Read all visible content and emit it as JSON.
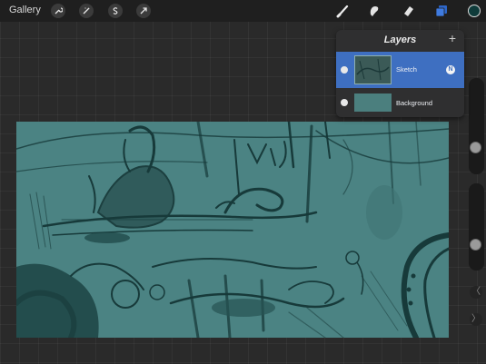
{
  "toolbar": {
    "gallery_label": "Gallery",
    "left_icons": [
      "wrench-icon",
      "magic-wand-icon",
      "selection-s-icon",
      "transform-arrow-icon"
    ],
    "right_icons": [
      "brush-icon",
      "smudge-icon",
      "eraser-icon",
      "layers-icon"
    ],
    "color_swatch": "#0f3b3a"
  },
  "layers_panel": {
    "title": "Layers",
    "add_symbol": "+",
    "layers": [
      {
        "name": "Sketch",
        "selected": true,
        "blend_mode": "N",
        "thumb_color": "#3b5a57"
      },
      {
        "name": "Background",
        "selected": false,
        "blend_mode": "",
        "thumb_color": "#4b7f7e"
      }
    ]
  },
  "canvas": {
    "background_color": "#4b8383",
    "ink_color": "#173a3a"
  },
  "sidebar": {
    "brush_size_level": 0.25,
    "opacity_level": 0.27,
    "undo_symbol": "〈",
    "redo_symbol": "〉"
  }
}
